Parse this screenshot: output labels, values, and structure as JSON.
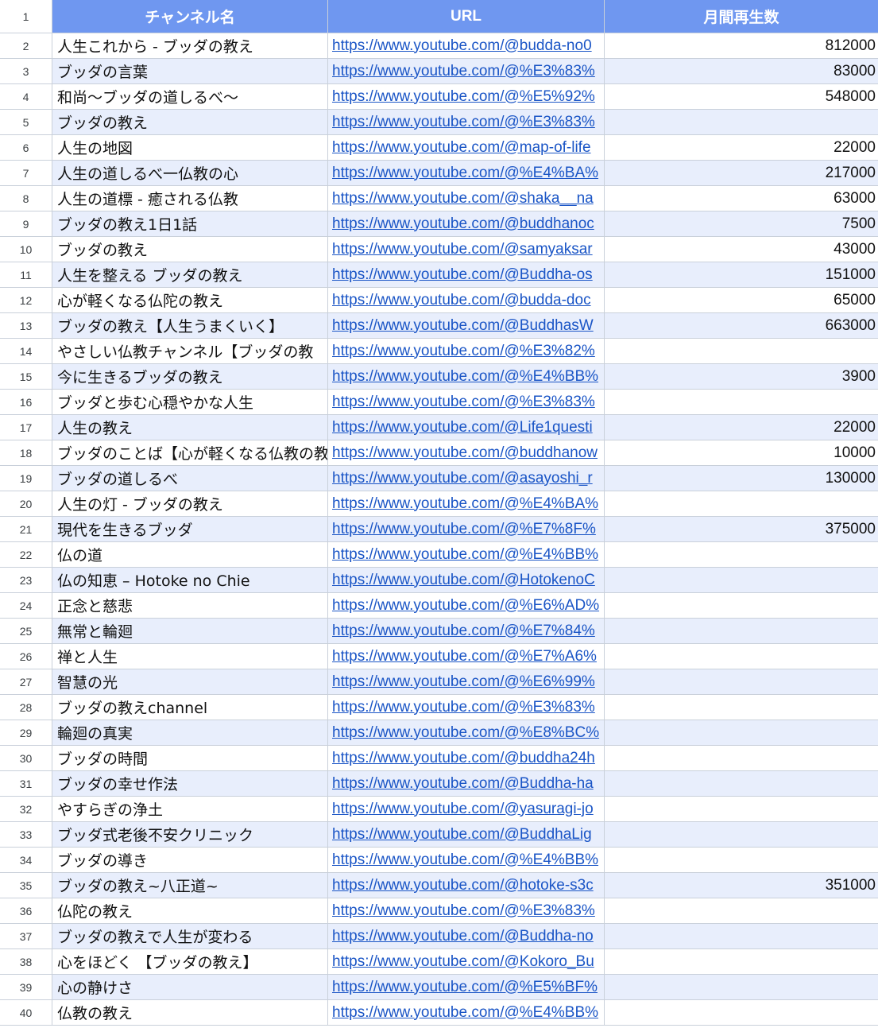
{
  "header": {
    "row_num": "1",
    "col_name": "チャンネル名",
    "col_url": "URL",
    "col_views": "月間再生数"
  },
  "rows": [
    {
      "n": "2",
      "name": "人生これから - ブッダの教え",
      "url": "https://www.youtube.com/@budda-no0",
      "views": "812000"
    },
    {
      "n": "3",
      "name": "ブッダの言葉",
      "url": "https://www.youtube.com/@%E3%83%",
      "views": "83000"
    },
    {
      "n": "4",
      "name": "和尚〜ブッダの道しるべ〜",
      "url": "https://www.youtube.com/@%E5%92%",
      "views": "548000"
    },
    {
      "n": "5",
      "name": "ブッダの教え",
      "url": "https://www.youtube.com/@%E3%83%",
      "views": ""
    },
    {
      "n": "6",
      "name": "人生の地図",
      "url": "https://www.youtube.com/@map-of-life",
      "views": "22000"
    },
    {
      "n": "7",
      "name": "人生の道しるべ一仏教の心",
      "url": "https://www.youtube.com/@%E4%BA%",
      "views": "217000"
    },
    {
      "n": "8",
      "name": "人生の道標 - 癒される仏教",
      "url": "https://www.youtube.com/@shaka__na",
      "views": "63000"
    },
    {
      "n": "9",
      "name": "ブッダの教え1日1話",
      "url": "https://www.youtube.com/@buddhanoc",
      "views": "7500"
    },
    {
      "n": "10",
      "name": "ブッダの教え",
      "url": "https://www.youtube.com/@samyaksar",
      "views": "43000"
    },
    {
      "n": "11",
      "name": "人生を整える ブッダの教え",
      "url": "https://www.youtube.com/@Buddha-os",
      "views": "151000"
    },
    {
      "n": "12",
      "name": "心が軽くなる仏陀の教え",
      "url": "https://www.youtube.com/@budda-doc",
      "views": "65000"
    },
    {
      "n": "13",
      "name": "ブッダの教え【人生うまくいく】",
      "url": "https://www.youtube.com/@BuddhasW",
      "views": "663000"
    },
    {
      "n": "14",
      "name": "やさしい仏教チャンネル【ブッダの教",
      "url": "https://www.youtube.com/@%E3%82%",
      "views": ""
    },
    {
      "n": "15",
      "name": "今に生きるブッダの教え",
      "url": "https://www.youtube.com/@%E4%BB%",
      "views": "3900"
    },
    {
      "n": "16",
      "name": "ブッダと歩む心穏やかな人生",
      "url": "https://www.youtube.com/@%E3%83%",
      "views": ""
    },
    {
      "n": "17",
      "name": "人生の教え",
      "url": "https://www.youtube.com/@Life1questi",
      "views": "22000"
    },
    {
      "n": "18",
      "name": "ブッダのことば【心が軽くなる仏教の教",
      "url": "https://www.youtube.com/@buddhanow",
      "views": "10000"
    },
    {
      "n": "19",
      "name": "ブッダの道しるべ",
      "url": "https://www.youtube.com/@asayoshi_r",
      "views": "130000"
    },
    {
      "n": "20",
      "name": "人生の灯 - ブッダの教え",
      "url": "https://www.youtube.com/@%E4%BA%",
      "views": ""
    },
    {
      "n": "21",
      "name": "現代を生きるブッダ",
      "url": "https://www.youtube.com/@%E7%8F%",
      "views": "375000"
    },
    {
      "n": "22",
      "name": "仏の道",
      "url": "https://www.youtube.com/@%E4%BB%",
      "views": ""
    },
    {
      "n": "23",
      "name": "仏の知恵 – Hotoke no Chie",
      "url": "https://www.youtube.com/@HotokenoC",
      "views": ""
    },
    {
      "n": "24",
      "name": "正念と慈悲",
      "url": "https://www.youtube.com/@%E6%AD%",
      "views": ""
    },
    {
      "n": "25",
      "name": "無常と輪廻",
      "url": "https://www.youtube.com/@%E7%84%",
      "views": ""
    },
    {
      "n": "26",
      "name": "禅と人生",
      "url": "https://www.youtube.com/@%E7%A6%",
      "views": ""
    },
    {
      "n": "27",
      "name": "智慧の光",
      "url": "https://www.youtube.com/@%E6%99%",
      "views": ""
    },
    {
      "n": "28",
      "name": "ブッダの教えchannel",
      "url": "https://www.youtube.com/@%E3%83%",
      "views": ""
    },
    {
      "n": "29",
      "name": "輪廻の真実",
      "url": "https://www.youtube.com/@%E8%BC%",
      "views": ""
    },
    {
      "n": "30",
      "name": "ブッダの時間",
      "url": "https://www.youtube.com/@buddha24h",
      "views": ""
    },
    {
      "n": "31",
      "name": "ブッダの幸せ作法",
      "url": "https://www.youtube.com/@Buddha-ha",
      "views": ""
    },
    {
      "n": "32",
      "name": "やすらぎの浄土",
      "url": "https://www.youtube.com/@yasuragi-jo",
      "views": ""
    },
    {
      "n": "33",
      "name": "ブッダ式老後不安クリニック",
      "url": "https://www.youtube.com/@BuddhaLig",
      "views": ""
    },
    {
      "n": "34",
      "name": "ブッダの導き",
      "url": "https://www.youtube.com/@%E4%BB%",
      "views": ""
    },
    {
      "n": "35",
      "name": "ブッダの教え~八正道~",
      "url": "https://www.youtube.com/@hotoke-s3c",
      "views": "351000"
    },
    {
      "n": "36",
      "name": "仏陀の教え",
      "url": "https://www.youtube.com/@%E3%83%",
      "views": ""
    },
    {
      "n": "37",
      "name": "ブッダの教えで人生が変わる",
      "url": "https://www.youtube.com/@Buddha-no",
      "views": ""
    },
    {
      "n": "38",
      "name": "心をほどく 【ブッダの教え】",
      "url": "https://www.youtube.com/@Kokoro_Bu",
      "views": ""
    },
    {
      "n": "39",
      "name": "心の静けさ",
      "url": "https://www.youtube.com/@%E5%BF%",
      "views": ""
    },
    {
      "n": "40",
      "name": "仏教の教え",
      "url": "https://www.youtube.com/@%E4%BB%",
      "views": ""
    }
  ]
}
